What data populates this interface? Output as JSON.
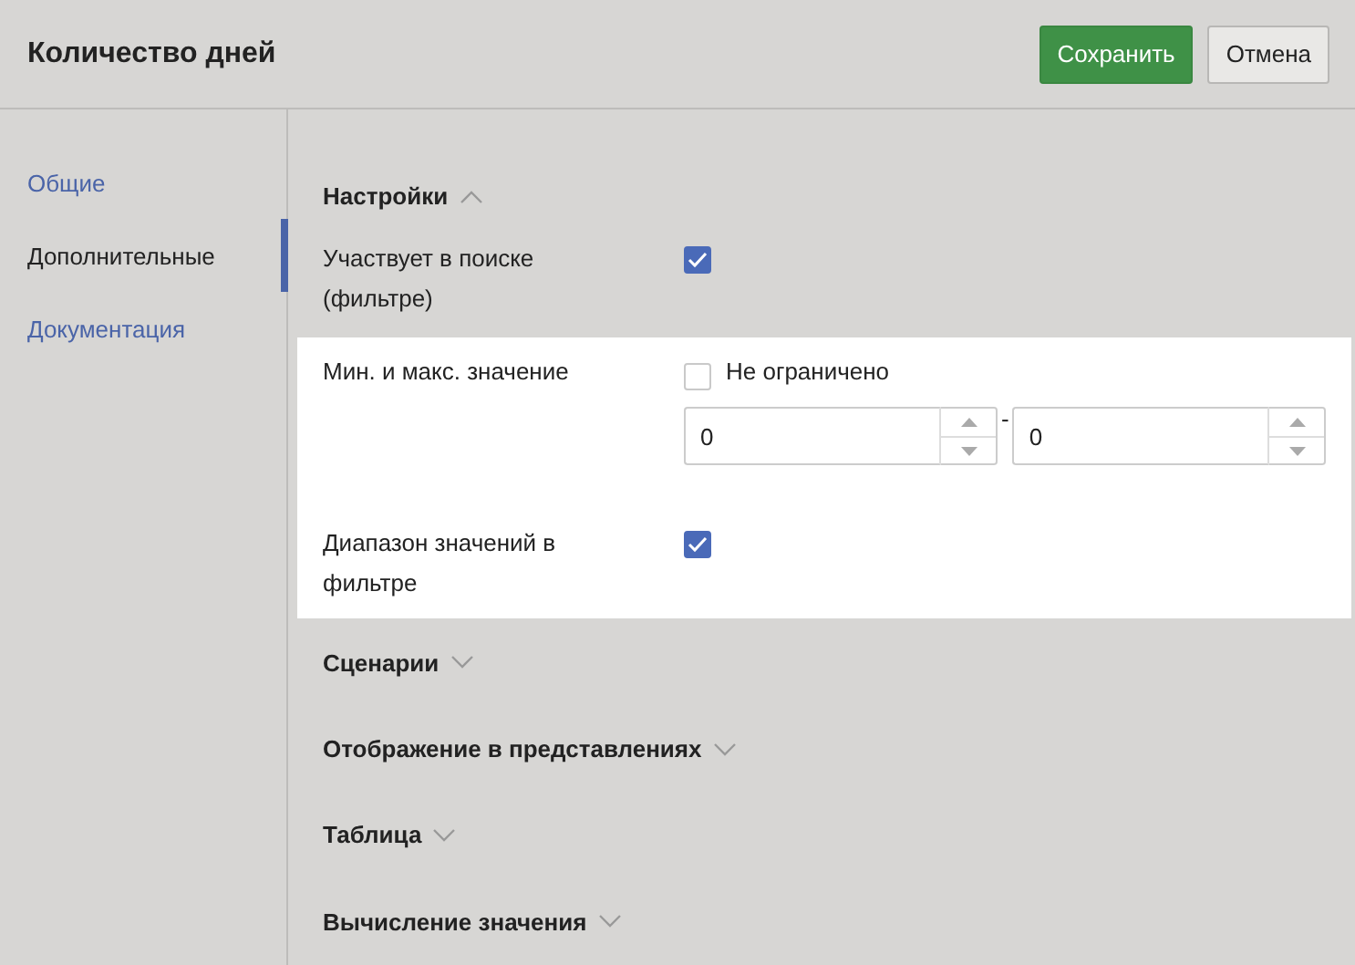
{
  "window": {
    "title": "Количество дней"
  },
  "buttons": [
    {
      "kind": "primary",
      "label": "Сохранить"
    },
    {
      "kind": "secondary",
      "label": "Отмена"
    }
  ],
  "sidebar": {
    "items": [
      {
        "label": "Общие",
        "selected": false
      },
      {
        "label": "Дополнительные",
        "selected": true
      },
      {
        "label": "Документация",
        "selected": false
      }
    ]
  },
  "sections": [
    {
      "title": "Настройки",
      "expanded": true,
      "rows": [
        {
          "kind": "checkbox",
          "label": "Участвует в поиске (фильтре)",
          "checked": true,
          "highlighted": false
        },
        {
          "kind": "range",
          "label": "Мин. и макс. значение",
          "highlighted": true,
          "unlimited": {
            "label": "Не ограничено",
            "checked": false
          },
          "min": "0",
          "separator": "-",
          "max": "0"
        },
        {
          "kind": "checkbox",
          "label": "Диапазон значений в фильтре",
          "checked": true,
          "highlighted": true
        }
      ]
    },
    {
      "title": "Сценарии",
      "expanded": false
    },
    {
      "title": "Отображение в представлениях",
      "expanded": false
    },
    {
      "title": "Таблица",
      "expanded": false
    },
    {
      "title": "Вычисление значения",
      "expanded": false
    }
  ]
}
